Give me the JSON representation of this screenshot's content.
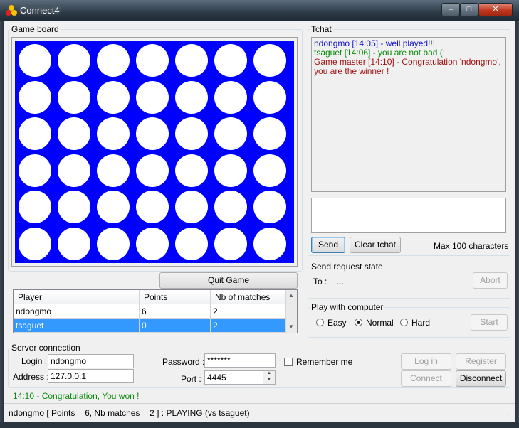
{
  "window": {
    "title": "Connect4",
    "controls": {
      "minimize": "–",
      "maximize": "□",
      "close": "✕"
    }
  },
  "game_board": {
    "legend": "Game board",
    "rows": 6,
    "columns": 7,
    "board_color": "#0000ff",
    "empty_cell_color": "#ffffff",
    "quit_label": "Quit Game"
  },
  "scores": {
    "headers": [
      "Player",
      "Points",
      "Nb of matches"
    ],
    "rows": [
      {
        "player": "ndongmo",
        "points": "6",
        "matches": "2"
      },
      {
        "player": "tsaguet",
        "points": "0",
        "matches": "2"
      }
    ]
  },
  "chat": {
    "legend": "Tchat",
    "messages": [
      {
        "text": "ndongmo [14:05] - well played!!!",
        "color": "#1515cc"
      },
      {
        "text": "tsaguet [14:06] - you are not bad (:",
        "color": "#0a8a0a"
      },
      {
        "text": "Game master [14:10] - Congratulation 'ndongmo', you are the winner !",
        "color": "#a01414"
      }
    ],
    "send_label": "Send",
    "clear_label": "Clear tchat",
    "max_label": "Max 100 characters"
  },
  "request": {
    "legend": "Send request state",
    "to_label": "To :",
    "to_value": "...",
    "abort_label": "Abort"
  },
  "computer": {
    "legend": "Play with computer",
    "options": [
      "Easy",
      "Normal",
      "Hard"
    ],
    "selected": "Normal",
    "start_label": "Start"
  },
  "server": {
    "legend": "Server connection",
    "login_label": "Login :",
    "login_value": "ndongmo",
    "address_label": "Address :",
    "address_value": "127.0.0.1",
    "password_label": "Password :",
    "password_value": "*******",
    "port_label": "Port :",
    "port_value": "4445",
    "remember_label": "Remember me",
    "login_button": "Log in",
    "register_button": "Register",
    "connect_button": "Connect",
    "disconnect_button": "Disconnect"
  },
  "status": {
    "message": "14:10 - Congratulation, You won !",
    "bar": "ndongmo [ Points = 6, Nb matches = 2 ] : PLAYING (vs tsaguet)"
  }
}
